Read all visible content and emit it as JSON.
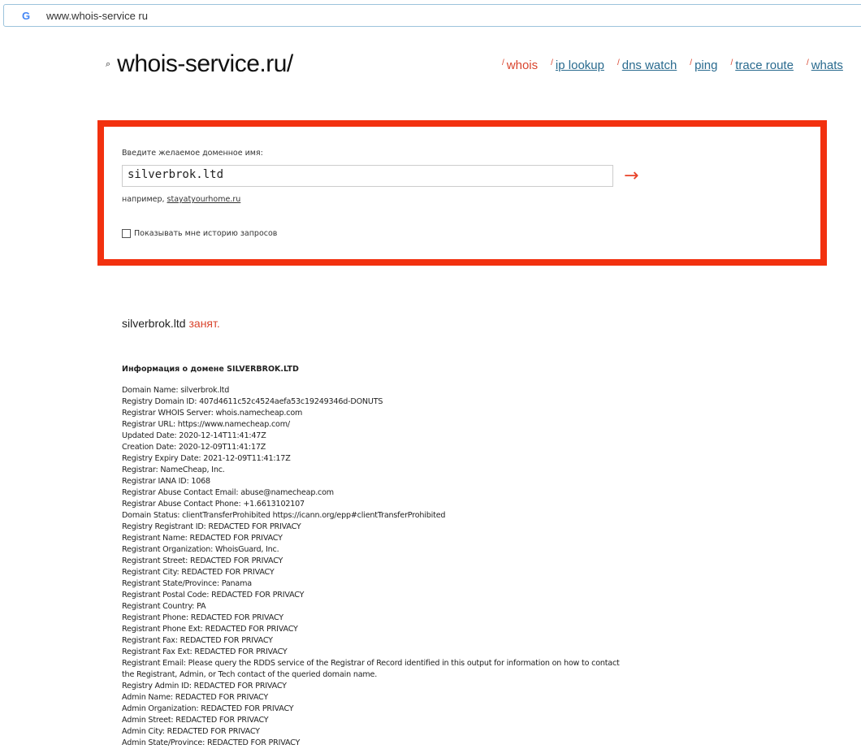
{
  "browser": {
    "url": "www.whois-service ru",
    "logo": "G"
  },
  "site": {
    "logo": "whois-service.ru/",
    "nav": [
      {
        "label": "whois",
        "active": true
      },
      {
        "label": "ip lookup"
      },
      {
        "label": "dns watch"
      },
      {
        "label": "ping"
      },
      {
        "label": "trace route"
      },
      {
        "label": "whats"
      }
    ]
  },
  "form": {
    "label": "Введите желаемое доменное имя:",
    "value": "silverbrok.ltd",
    "arrow": "→",
    "example_prefix": "например, ",
    "example_link": "stayatyourhome.ru",
    "history_label": "Показывать мне историю запросов"
  },
  "result": {
    "domain": "silverbrok.ltd",
    "status": "занят.",
    "info_title": "Информация о домене SILVERBROK.LTD",
    "lines": [
      "Domain Name: silverbrok.ltd",
      "Registry Domain ID: 407d4611c52c4524aefa53c19249346d-DONUTS",
      "Registrar WHOIS Server: whois.namecheap.com",
      "Registrar URL: https://www.namecheap.com/",
      "Updated Date: 2020-12-14T11:41:47Z",
      "Creation Date: 2020-12-09T11:41:17Z",
      "Registry Expiry Date: 2021-12-09T11:41:17Z",
      "Registrar: NameCheap, Inc.",
      "Registrar IANA ID: 1068",
      "Registrar Abuse Contact Email: abuse@namecheap.com",
      "Registrar Abuse Contact Phone: +1.6613102107",
      "Domain Status: clientTransferProhibited https://icann.org/epp#clientTransferProhibited",
      "Registry Registrant ID: REDACTED FOR PRIVACY",
      "Registrant Name: REDACTED FOR PRIVACY",
      "Registrant Organization: WhoisGuard, Inc.",
      "Registrant Street: REDACTED FOR PRIVACY",
      "Registrant City: REDACTED FOR PRIVACY",
      "Registrant State/Province: Panama",
      "Registrant Postal Code: REDACTED FOR PRIVACY",
      "Registrant Country: PA",
      "Registrant Phone: REDACTED FOR PRIVACY",
      "Registrant Phone Ext: REDACTED FOR PRIVACY",
      "Registrant Fax: REDACTED FOR PRIVACY",
      "Registrant Fax Ext: REDACTED FOR PRIVACY",
      "Registrant Email: Please query the RDDS service of the Registrar of Record identified in this output for information on how to contact the Registrant, Admin, or Tech contact of the queried domain name.",
      "Registry Admin ID: REDACTED FOR PRIVACY",
      "Admin Name: REDACTED FOR PRIVACY",
      "Admin Organization: REDACTED FOR PRIVACY",
      "Admin Street: REDACTED FOR PRIVACY",
      "Admin City: REDACTED FOR PRIVACY",
      "Admin State/Province: REDACTED FOR PRIVACY"
    ]
  }
}
